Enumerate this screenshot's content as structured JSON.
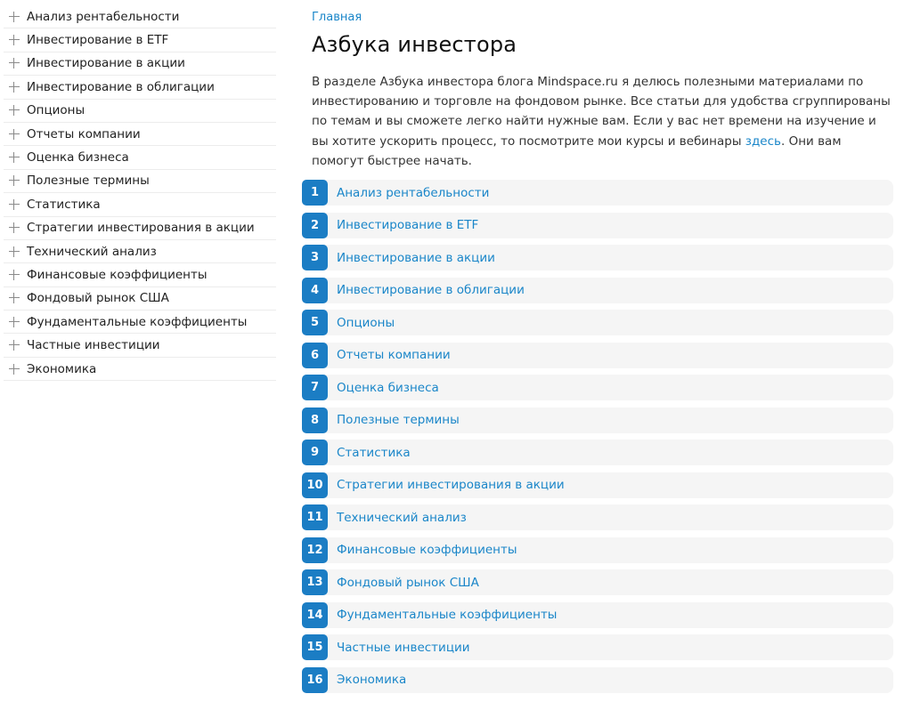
{
  "sidebar": {
    "items": [
      {
        "label": "Анализ рентабельности"
      },
      {
        "label": "Инвестирование в ETF"
      },
      {
        "label": "Инвестирование в акции"
      },
      {
        "label": "Инвестирование в облигации"
      },
      {
        "label": "Опционы"
      },
      {
        "label": "Отчеты компании"
      },
      {
        "label": "Оценка бизнеса"
      },
      {
        "label": "Полезные термины"
      },
      {
        "label": "Статистика"
      },
      {
        "label": "Стратегии инвестирования в акции"
      },
      {
        "label": "Технический анализ"
      },
      {
        "label": "Финансовые коэффициенты"
      },
      {
        "label": "Фондовый рынок США"
      },
      {
        "label": "Фундаментальные коэффициенты"
      },
      {
        "label": "Частные инвестиции"
      },
      {
        "label": "Экономика"
      }
    ]
  },
  "main": {
    "breadcrumb": "Главная",
    "title": "Азбука инвестора",
    "intro": {
      "text_before": "В разделе Азбука инвестора блога Mindspace.ru я делюсь полезными материалами по инвестированию и торговле на фондовом рынке. Все статьи для удобства сгруппированы по темам и вы сможете легко найти нужные вам. Если у вас нет времени на изучение и вы хотите ускорить процесс, то посмотрите мои курсы и вебинары ",
      "link": "здесь",
      "text_after": ". Они вам помогут быстрее начать."
    },
    "topics": [
      {
        "num": "1",
        "label": "Анализ рентабельности"
      },
      {
        "num": "2",
        "label": "Инвестирование в ETF"
      },
      {
        "num": "3",
        "label": "Инвестирование в акции"
      },
      {
        "num": "4",
        "label": "Инвестирование в облигации"
      },
      {
        "num": "5",
        "label": "Опционы"
      },
      {
        "num": "6",
        "label": "Отчеты компании"
      },
      {
        "num": "7",
        "label": "Оценка бизнеса"
      },
      {
        "num": "8",
        "label": "Полезные термины"
      },
      {
        "num": "9",
        "label": "Статистика"
      },
      {
        "num": "10",
        "label": "Стратегии инвестирования в акции"
      },
      {
        "num": "11",
        "label": "Технический анализ"
      },
      {
        "num": "12",
        "label": "Финансовые коэффициенты"
      },
      {
        "num": "13",
        "label": "Фондовый рынок США"
      },
      {
        "num": "14",
        "label": "Фундаментальные коэффициенты"
      },
      {
        "num": "15",
        "label": "Частные инвестиции"
      },
      {
        "num": "16",
        "label": "Экономика"
      }
    ]
  },
  "colors": {
    "accent": "#1b7dc4",
    "link": "#1a86c9",
    "row_background": "#f5f5f5"
  },
  "icons": {
    "sidebar_expander": "plus-icon"
  }
}
